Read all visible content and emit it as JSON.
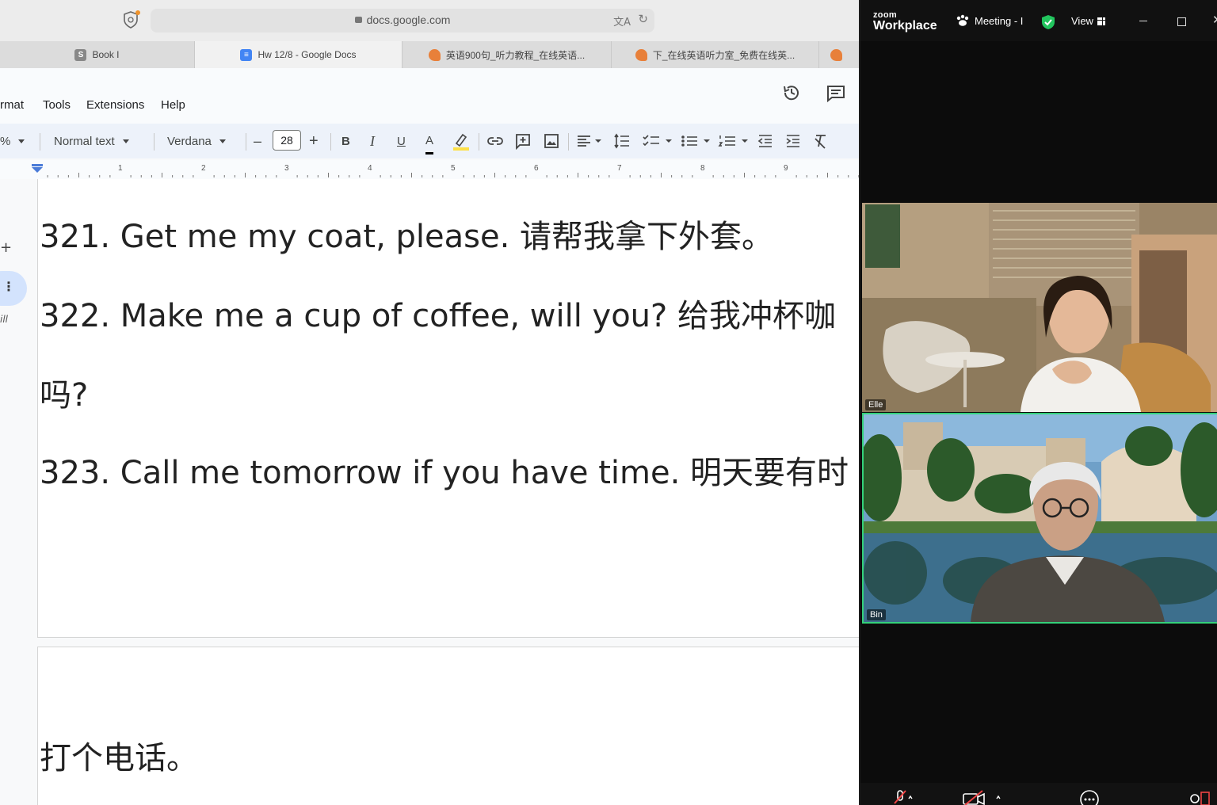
{
  "browser": {
    "url": "docs.google.com",
    "tabs": [
      {
        "label": "Book I",
        "icon": "s-icon"
      },
      {
        "label": "Hw 12/8 - Google Docs",
        "icon": "docs-icon"
      },
      {
        "label": "英语900句_听力教程_在线英语...",
        "icon": "bird-icon"
      },
      {
        "label": "下_在线英语听力室_免费在线英...",
        "icon": "bird-icon"
      }
    ]
  },
  "docs": {
    "menu": [
      "rmat",
      "Tools",
      "Extensions",
      "Help"
    ],
    "toolbar": {
      "zoom": "%",
      "style": "Normal text",
      "font": "Verdana",
      "font_size": "28",
      "minus": "–",
      "plus": "+",
      "bold": "B",
      "italic": "I",
      "underline": "U",
      "text_color": "A"
    },
    "ruler_numbers": [
      "1",
      "2",
      "3",
      "4",
      "5",
      "6",
      "7",
      "8",
      "9"
    ],
    "left_rail": {
      "plus": "+",
      "dots": "⋮",
      "text": "ill"
    },
    "lines": [
      "321. Get me my coat, please. 请帮我拿下外套。",
      "322. Make me a cup of coffee, will you? 给我冲杯咖",
      "吗?",
      "323. Call me tomorrow if you have time. 明天要有时",
      "打个电话。"
    ]
  },
  "zoom": {
    "brand_small": "zoom",
    "brand_large": "Workplace",
    "meeting_label": "Meeting - I",
    "view_label": "View",
    "close": "✕",
    "participants": [
      {
        "name": "Elle"
      },
      {
        "name": "Bin"
      }
    ],
    "colors": {
      "active_speaker": "#34d17a",
      "secure": "#22c55e"
    }
  }
}
